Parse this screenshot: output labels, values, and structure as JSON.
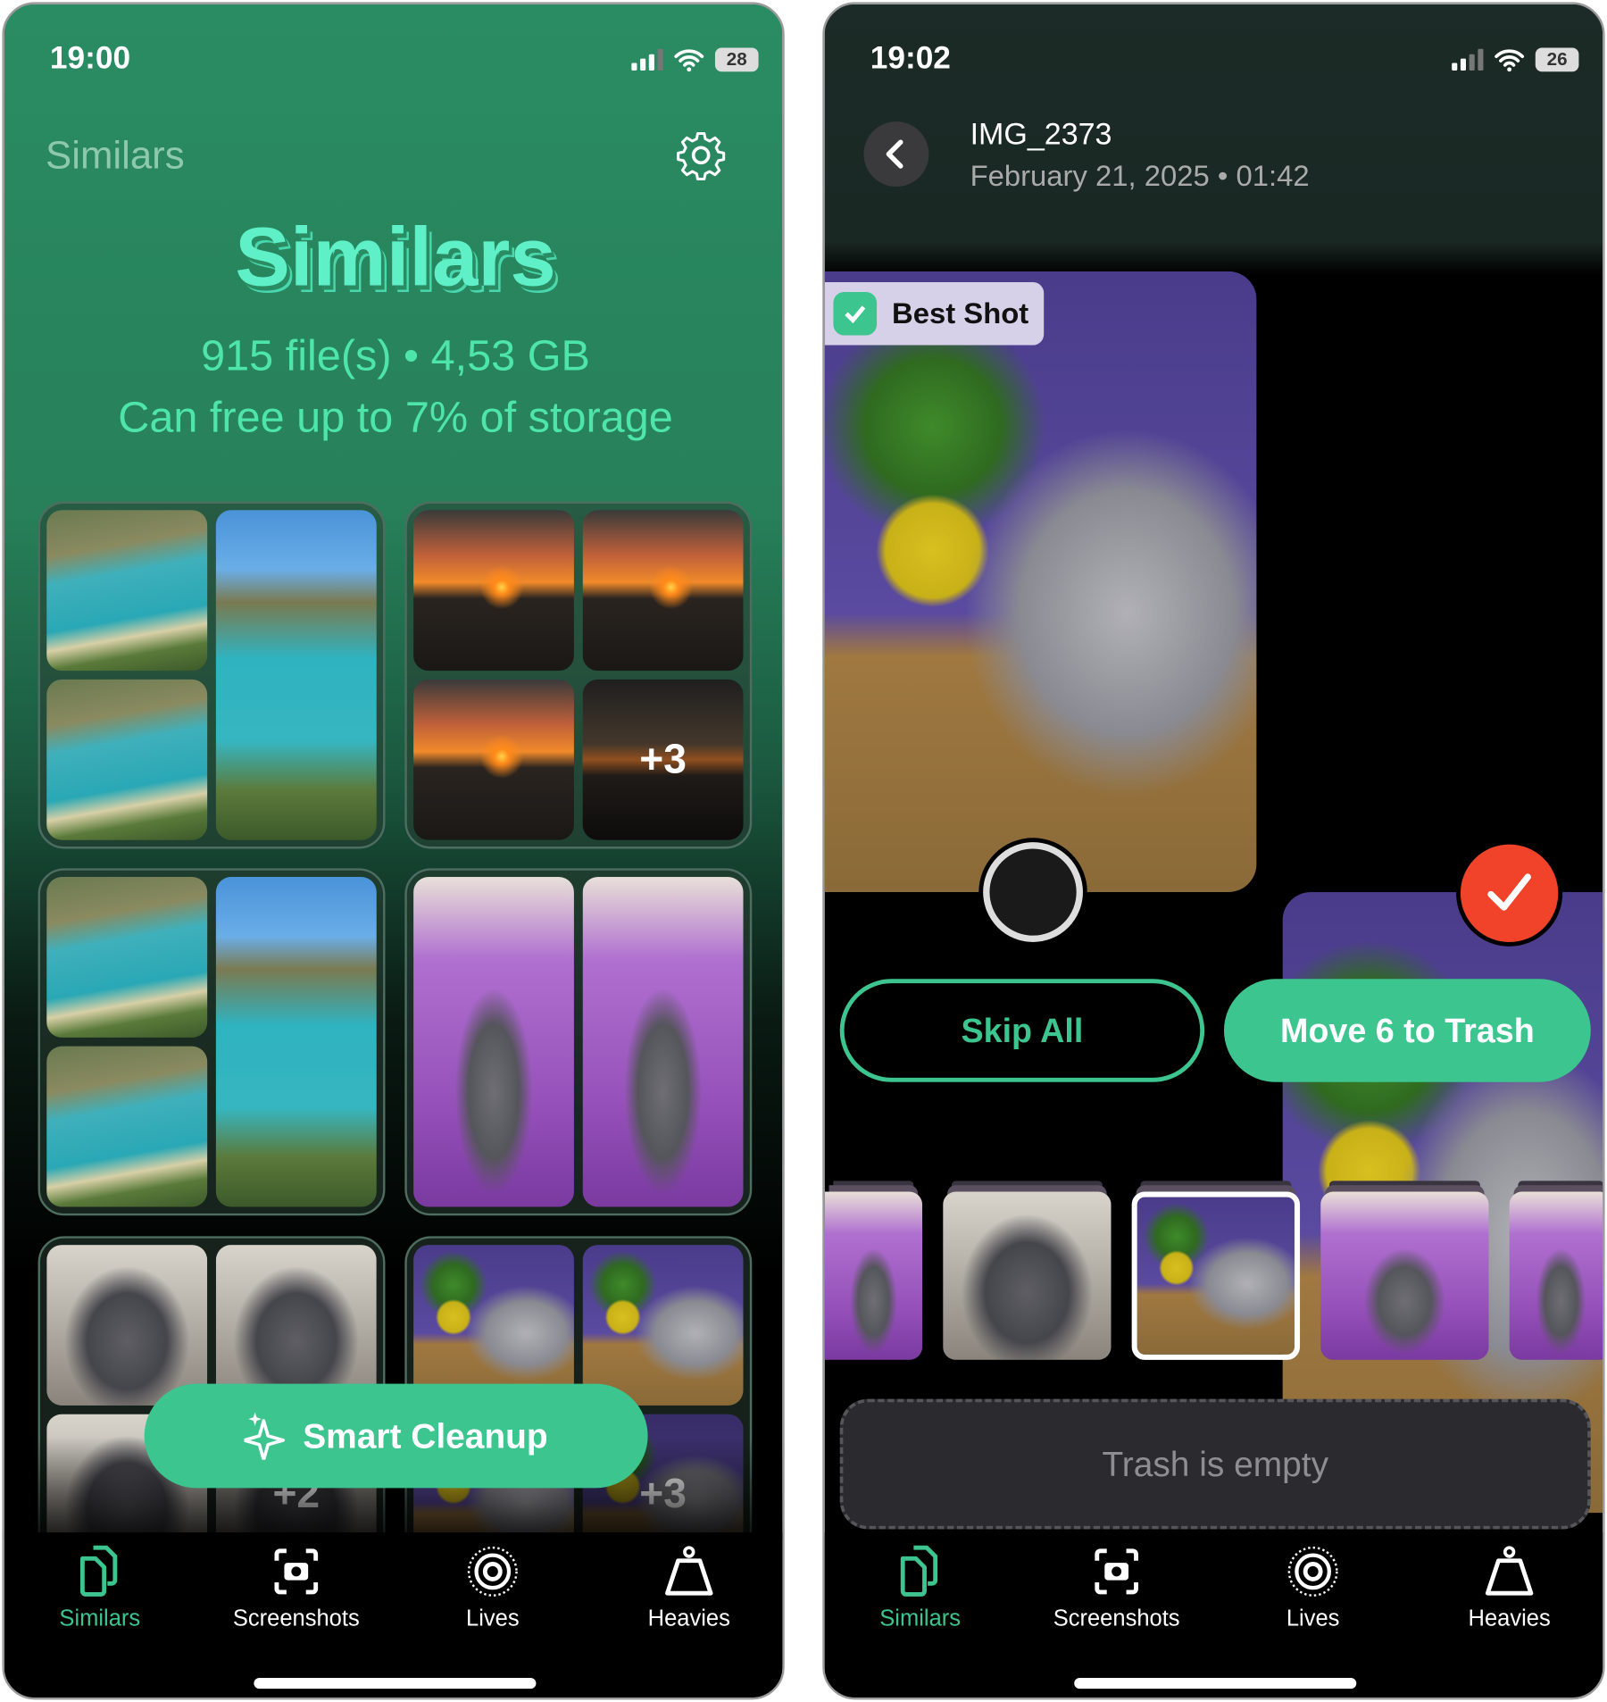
{
  "left": {
    "status": {
      "time": "19:00",
      "battery": "28"
    },
    "nav_title": "Similars",
    "hero_title": "Similars",
    "summary": "915 file(s) • 4,53 GB",
    "savings": "Can free up to 7% of storage",
    "groups": [
      {
        "type": "beach"
      },
      {
        "type": "sunset",
        "more": "+3"
      },
      {
        "type": "beach"
      },
      {
        "type": "cat-purple"
      },
      {
        "type": "cat-gray",
        "more": "+2"
      },
      {
        "type": "cat-plant",
        "more": "+3"
      }
    ],
    "cta": "Smart Cleanup"
  },
  "right": {
    "status": {
      "time": "19:02",
      "battery": "26"
    },
    "file_name": "IMG_2373",
    "file_date": "February 21, 2025 • 01:42",
    "best_shot": "Best Shot",
    "skip_label": "Skip All",
    "trash_label": "Move 6 to Trash",
    "trash_empty": "Trash is empty"
  },
  "tabs": [
    {
      "label": "Similars",
      "icon": "similars-icon",
      "active": true
    },
    {
      "label": "Screenshots",
      "icon": "screenshot-icon"
    },
    {
      "label": "Lives",
      "icon": "live-photo-icon"
    },
    {
      "label": "Heavies",
      "icon": "weight-icon"
    }
  ],
  "colors": {
    "accent": "#3cc58f",
    "hero": "#5ff0c8",
    "selected_red": "#f0432a"
  }
}
